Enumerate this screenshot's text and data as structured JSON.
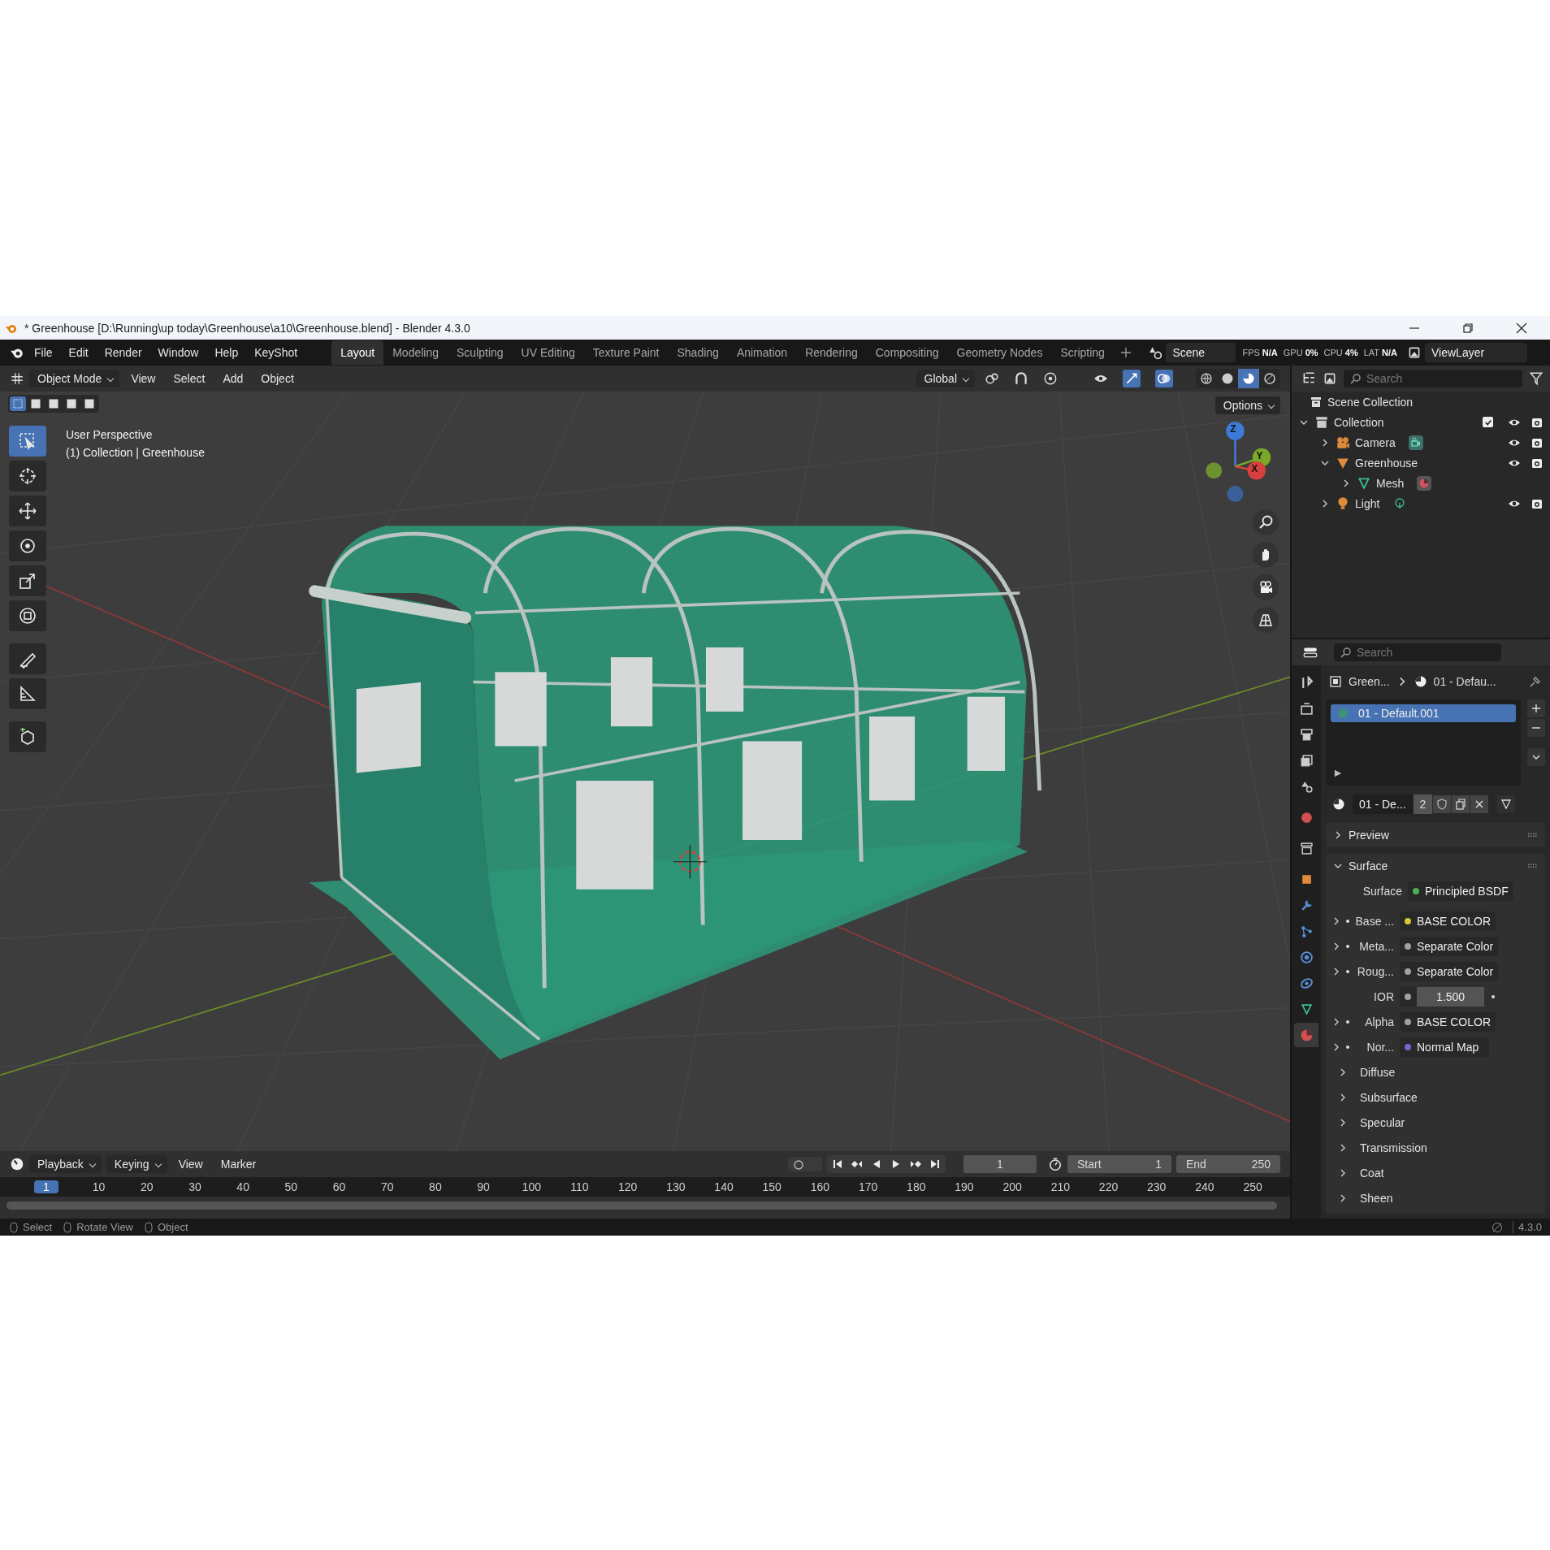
{
  "window": {
    "title": "* Greenhouse [D:\\Running\\up today\\Greenhouse\\a10\\Greenhouse.blend] - Blender 4.3.0"
  },
  "menu": [
    "File",
    "Edit",
    "Render",
    "Window",
    "Help",
    "KeyShot"
  ],
  "workspaces": [
    {
      "label": "Layout",
      "selected": true
    },
    {
      "label": "Modeling",
      "selected": false
    },
    {
      "label": "Sculpting",
      "selected": false
    },
    {
      "label": "UV Editing",
      "selected": false
    },
    {
      "label": "Texture Paint",
      "selected": false
    },
    {
      "label": "Shading",
      "selected": false
    },
    {
      "label": "Animation",
      "selected": false
    },
    {
      "label": "Rendering",
      "selected": false
    },
    {
      "label": "Compositing",
      "selected": false
    },
    {
      "label": "Geometry Nodes",
      "selected": false
    },
    {
      "label": "Scripting",
      "selected": false
    }
  ],
  "stats": [
    {
      "label": "FPS",
      "value": "N/A"
    },
    {
      "label": "GPU",
      "value": "0%"
    },
    {
      "label": "CPU",
      "value": "4%"
    },
    {
      "label": "LAT",
      "value": "N/A"
    }
  ],
  "scene": "Scene",
  "view_layer": "ViewLayer",
  "viewport": {
    "mode": "Object Mode",
    "menus": [
      "View",
      "Select",
      "Add",
      "Object"
    ],
    "orientation": "Global",
    "options": "Options",
    "select_modes": [
      {
        "selected": true
      },
      {
        "selected": false
      },
      {
        "selected": false
      },
      {
        "selected": false
      },
      {
        "selected": false
      }
    ],
    "shading": [
      {
        "kind": "wireframe",
        "selected": false
      },
      {
        "kind": "solid",
        "selected": false
      },
      {
        "kind": "material",
        "selected": true
      },
      {
        "kind": "rendered",
        "selected": false
      }
    ],
    "info": [
      "User Perspective",
      "(1) Collection | Greenhouse"
    ],
    "axes": [
      "Z",
      "Y",
      "X"
    ],
    "tools": [
      {
        "kind": "select",
        "selected": true
      },
      {
        "kind": "cursor",
        "selected": false
      },
      {
        "kind": "move",
        "selected": false
      },
      {
        "kind": "rotate",
        "selected": false
      },
      {
        "kind": "scale",
        "selected": false
      },
      {
        "kind": "transform",
        "selected": false
      },
      {
        "kind": "annotate",
        "selected": false
      },
      {
        "kind": "measure",
        "selected": false
      },
      {
        "kind": "add-cube",
        "selected": false
      }
    ]
  },
  "outliner": {
    "search_placeholder": "Search",
    "root": "Scene Collection",
    "items": [
      {
        "label": "Collection",
        "kind": "collection",
        "expanded": true,
        "checked": true,
        "children": [
          {
            "label": "Camera",
            "kind": "camera",
            "expanded": false
          },
          {
            "label": "Greenhouse",
            "kind": "mesh-object",
            "expanded": true,
            "children": [
              {
                "label": "Mesh",
                "kind": "mesh-data",
                "expanded": false
              }
            ]
          },
          {
            "label": "Light",
            "kind": "light",
            "expanded": false
          }
        ]
      }
    ]
  },
  "properties": {
    "search_placeholder": "Search",
    "tabs": [
      {
        "kind": "tool",
        "selected": false
      },
      {
        "kind": "render",
        "selected": false
      },
      {
        "kind": "output",
        "selected": false
      },
      {
        "kind": "view-layer",
        "selected": false
      },
      {
        "kind": "scene",
        "selected": false
      },
      {
        "kind": "world",
        "selected": false
      },
      {
        "kind": "collection",
        "selected": false
      },
      {
        "kind": "object",
        "selected": false
      },
      {
        "kind": "modifier",
        "selected": false
      },
      {
        "kind": "particles",
        "selected": false
      },
      {
        "kind": "physics",
        "selected": false
      },
      {
        "kind": "constraints",
        "selected": false
      },
      {
        "kind": "data",
        "selected": false
      },
      {
        "kind": "material",
        "selected": true
      }
    ],
    "breadcrumb": [
      "Green...",
      "01 - Defau..."
    ],
    "slots": [
      {
        "label": "01 - Default.001",
        "selected": true
      }
    ],
    "material_name": "01 - De...",
    "users": "2",
    "panels": [
      {
        "label": "Preview",
        "expanded": false
      },
      {
        "label": "Surface",
        "expanded": true
      }
    ],
    "surface": {
      "label": "Surface",
      "value": "Principled BSDF",
      "color": "#4caf50"
    },
    "inputs": [
      {
        "kind": "link",
        "label": "Base ...",
        "value": "BASE COLOR",
        "color": "#d6c832"
      },
      {
        "kind": "link",
        "label": "Meta...",
        "value": "Separate Color",
        "color": "#a0a0a0"
      },
      {
        "kind": "link",
        "label": "Roug...",
        "value": "Separate Color",
        "color": "#a0a0a0"
      },
      {
        "kind": "number",
        "label": "IOR",
        "value": "1.500",
        "color": "#a0a0a0"
      },
      {
        "kind": "link",
        "label": "Alpha",
        "value": "BASE COLOR",
        "color": "#a0a0a0"
      },
      {
        "kind": "link",
        "label": "Nor...",
        "value": "Normal Map",
        "color": "#6b6bd0"
      }
    ],
    "subpanels": [
      {
        "label": "Diffuse",
        "expanded": false
      },
      {
        "label": "Subsurface",
        "expanded": false
      },
      {
        "label": "Specular",
        "expanded": false
      },
      {
        "label": "Transmission",
        "expanded": false
      },
      {
        "label": "Coat",
        "expanded": false
      },
      {
        "label": "Sheen",
        "expanded": false
      }
    ]
  },
  "timeline": {
    "menus": [
      {
        "label": "Playback",
        "kind": "dropdown"
      },
      {
        "label": "Keying",
        "kind": "dropdown"
      },
      {
        "label": "View",
        "kind": "menu"
      },
      {
        "label": "Marker",
        "kind": "menu"
      }
    ],
    "current_frame": "1",
    "start_label": "Start",
    "start": "1",
    "end_label": "End",
    "end": "250",
    "ruler": [
      {
        "label": "1",
        "selected": true
      },
      {
        "label": "10",
        "selected": false
      },
      {
        "label": "20",
        "selected": false
      },
      {
        "label": "30",
        "selected": false
      },
      {
        "label": "40",
        "selected": false
      },
      {
        "label": "50",
        "selected": false
      },
      {
        "label": "60",
        "selected": false
      },
      {
        "label": "70",
        "selected": false
      },
      {
        "label": "80",
        "selected": false
      },
      {
        "label": "90",
        "selected": false
      },
      {
        "label": "100",
        "selected": false
      },
      {
        "label": "110",
        "selected": false
      },
      {
        "label": "120",
        "selected": false
      },
      {
        "label": "130",
        "selected": false
      },
      {
        "label": "140",
        "selected": false
      },
      {
        "label": "150",
        "selected": false
      },
      {
        "label": "160",
        "selected": false
      },
      {
        "label": "170",
        "selected": false
      },
      {
        "label": "180",
        "selected": false
      },
      {
        "label": "190",
        "selected": false
      },
      {
        "label": "200",
        "selected": false
      },
      {
        "label": "210",
        "selected": false
      },
      {
        "label": "220",
        "selected": false
      },
      {
        "label": "230",
        "selected": false
      },
      {
        "label": "240",
        "selected": false
      },
      {
        "label": "250",
        "selected": false
      }
    ]
  },
  "status_bar": {
    "hints": [
      "Select",
      "Rotate View",
      "Object"
    ],
    "version": "4.3.0"
  }
}
